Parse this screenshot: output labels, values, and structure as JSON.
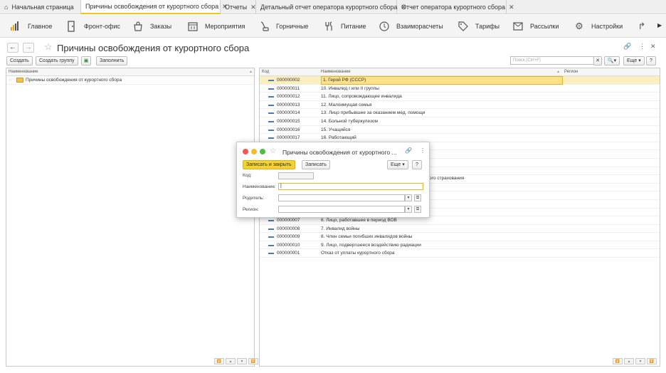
{
  "tabs": [
    {
      "label": "Начальная страница",
      "closable": false
    },
    {
      "label": "Причины освобождения от курортного сбора",
      "closable": true,
      "active": true
    },
    {
      "label": "Отчеты",
      "closable": true
    },
    {
      "label": "Детальный отчет оператора курортного сбора",
      "closable": true
    },
    {
      "label": "Отчет оператора курортного сбора",
      "closable": true
    }
  ],
  "menu": [
    {
      "label": "Главное",
      "icon": "chart-icon"
    },
    {
      "label": "Фронт-офис",
      "icon": "door-icon"
    },
    {
      "label": "Заказы",
      "icon": "bag-icon"
    },
    {
      "label": "Мероприятия",
      "icon": "calendar-icon"
    },
    {
      "label": "Горничные",
      "icon": "vacuum-icon"
    },
    {
      "label": "Питание",
      "icon": "food-icon"
    },
    {
      "label": "Взаиморасчеты",
      "icon": "exchange-icon"
    },
    {
      "label": "Тарифы",
      "icon": "tag-icon"
    },
    {
      "label": "Рассылки",
      "icon": "mail-icon"
    },
    {
      "label": "Настройки",
      "icon": "gear-icon"
    }
  ],
  "page": {
    "title": "Причины освобождения от курортного сбора"
  },
  "toolbar": {
    "create": "Создать",
    "create_group": "Создать группу",
    "fill": "Заполнить",
    "search_placeholder": "Поиск (Ctrl+F)",
    "more": "Еще",
    "help": "?"
  },
  "left": {
    "col_name": "Наименование",
    "root": "Причины освобождения от курортного сбора"
  },
  "right": {
    "col_code": "Код",
    "col_name": "Наименование",
    "col_region": "Регион",
    "rows": [
      {
        "code": "000000002",
        "name": "1. Герой РФ (СССР)"
      },
      {
        "code": "000000011",
        "name": "10. Инвалид I или II группы"
      },
      {
        "code": "000000012",
        "name": "11. Лицо, сопровождающее инвалида"
      },
      {
        "code": "000000013",
        "name": "12. Малоимущая семья"
      },
      {
        "code": "000000014",
        "name": "13. Лицо прибывшее за оказанием мед. помощи"
      },
      {
        "code": "000000015",
        "name": "14. Больной туберкулезом"
      },
      {
        "code": "000000016",
        "name": "15. Учащийся"
      },
      {
        "code": "000000017",
        "name": "16. Работающий"
      },
      {
        "code": "",
        "name": ""
      },
      {
        "code": "",
        "name": ""
      },
      {
        "code": "",
        "name": ""
      },
      {
        "code": "",
        "name": ""
      },
      {
        "code": "",
        "name": ""
      },
      {
        "code": "",
        "name": ""
      },
      {
        "code": "",
        "name": ""
      },
      {
        "code": "",
        "name": ""
      },
      {
        "code": "",
        "name": ""
      },
      {
        "code": "000000007",
        "name": "6. Лицо, работавшее в период ВОВ"
      },
      {
        "code": "000000008",
        "name": "7. Инвалид войны"
      },
      {
        "code": "000000009",
        "name": "8. Член семьи погибших инвалидов войны"
      },
      {
        "code": "000000010",
        "name": "9. Лицо, подвергшееся воздействию радиации"
      },
      {
        "code": "000000001",
        "name": "Отказ от уплаты курортного сбора"
      }
    ],
    "hidden_fragment": "ого страхования"
  },
  "dialog": {
    "title": "Причины освобождения от курортного ...",
    "save_close": "Записать и закрыть",
    "save": "Записать",
    "more": "Еще",
    "help": "?",
    "code_label": "Код:",
    "name_label": "Наименование:",
    "parent_label": "Родитель:",
    "region_label": "Регион:",
    "code_value": "",
    "name_value": "|"
  },
  "colors": {
    "accent": "#f0c419",
    "selected_row": "#fbefc0",
    "save_button": "#f5d22e"
  }
}
